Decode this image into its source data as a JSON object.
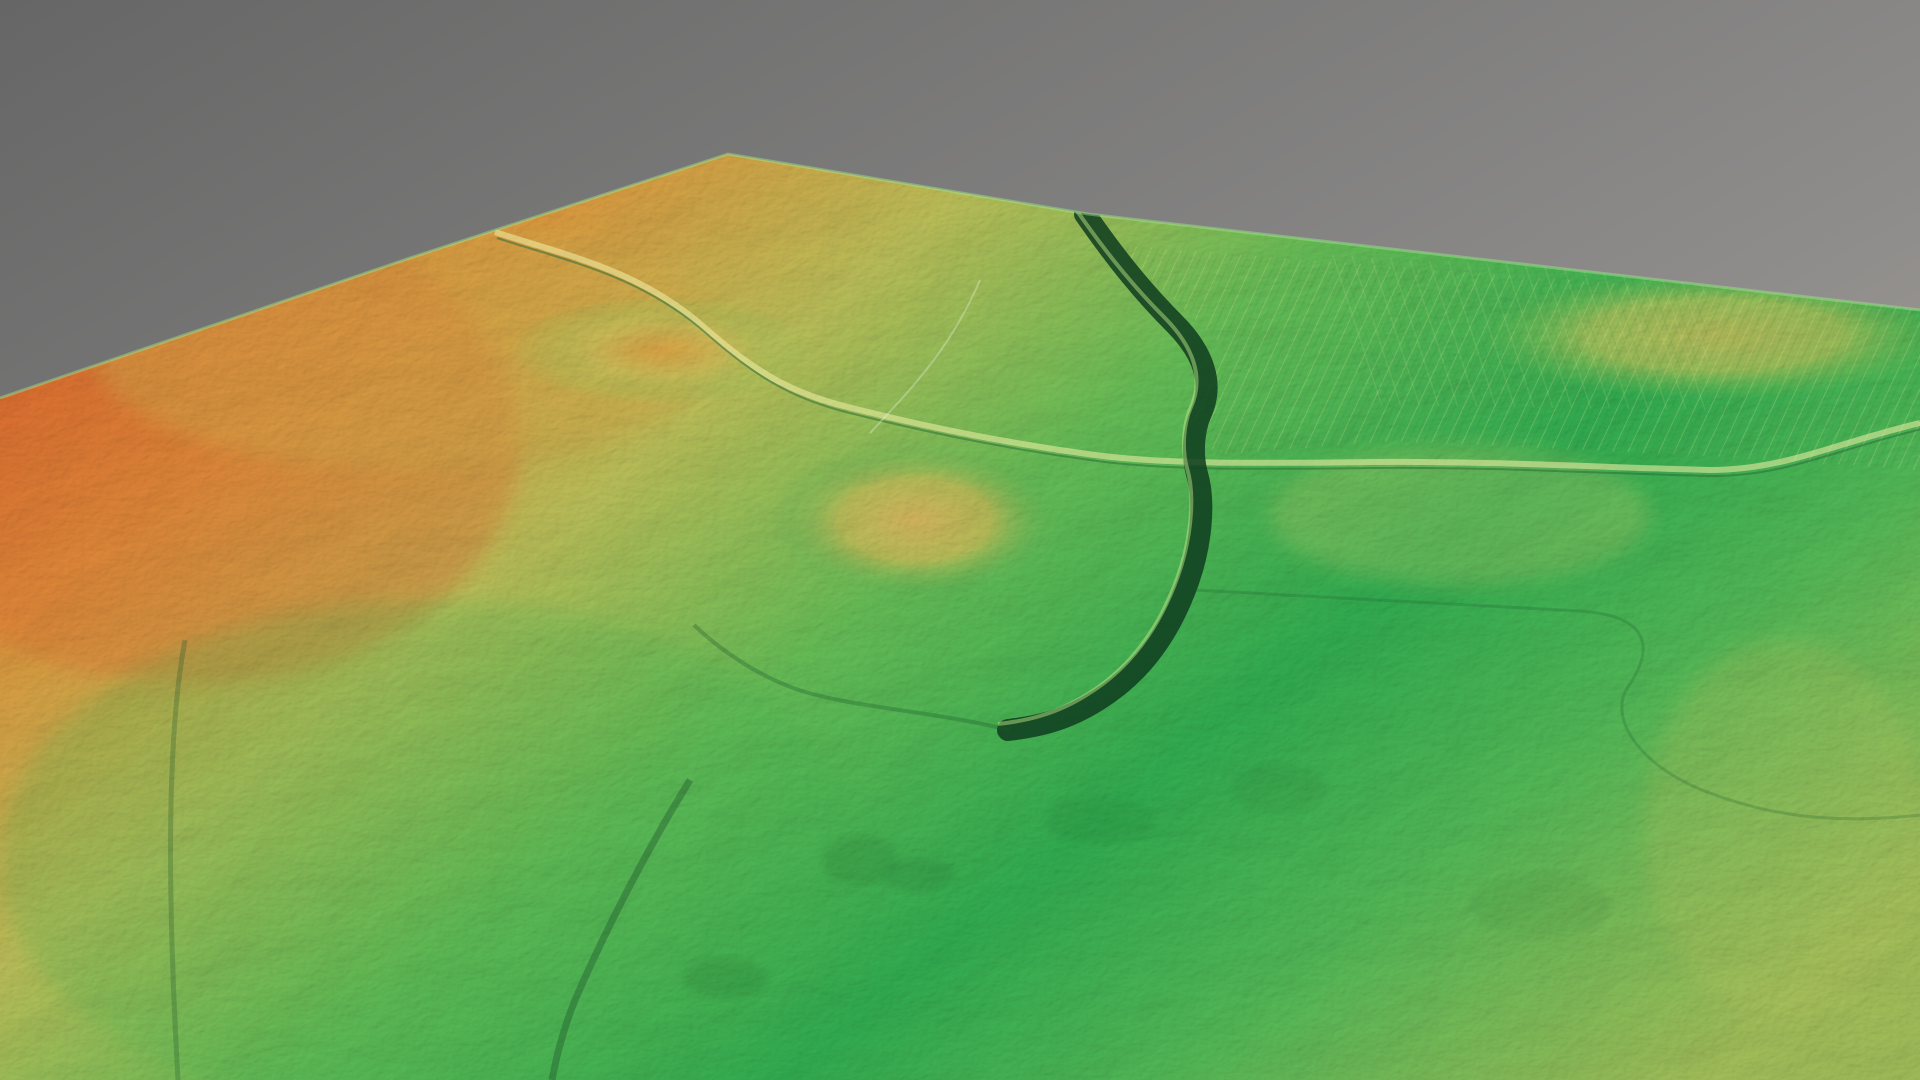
{
  "scene": {
    "view": "3d-terrain-elevation-model",
    "colormap": "elevation-green-to-orange",
    "colors": {
      "sky_top": "#6f6f6f",
      "sky_bottom": "#b3aaa1",
      "low_elevation": "#2eae52",
      "mid_elevation": "#7fc85b",
      "high_elevation": "#d9b35a",
      "peak_elevation": "#e0762f",
      "channel": "#123b22"
    },
    "features": [
      "terrain-surface",
      "drainage-channel",
      "farm-track",
      "field-boundary",
      "rounded-hill",
      "ridge-slope",
      "plough-furrows"
    ]
  }
}
